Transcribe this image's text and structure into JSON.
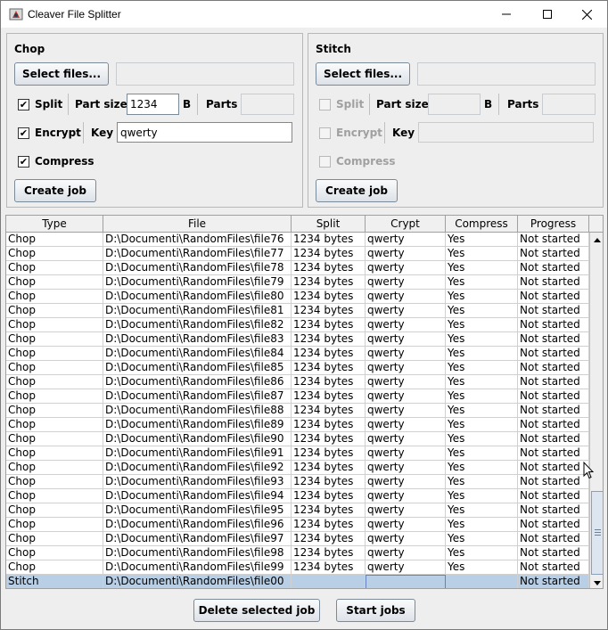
{
  "window": {
    "title": "Cleaver File Splitter"
  },
  "chop": {
    "title": "Chop",
    "select_files_label": "Select files...",
    "files_value": "",
    "split_label": "Split",
    "split_checked": true,
    "part_size_label": "Part size",
    "part_size_value": "1234",
    "part_size_unit": "B",
    "parts_label": "Parts",
    "parts_value": "",
    "encrypt_label": "Encrypt",
    "encrypt_checked": true,
    "key_label": "Key",
    "key_value": "qwerty",
    "compress_label": "Compress",
    "compress_checked": true,
    "create_job_label": "Create job"
  },
  "stitch": {
    "title": "Stitch",
    "select_files_label": "Select files...",
    "files_value": "",
    "split_label": "Split",
    "part_size_label": "Part size",
    "part_size_value": "",
    "part_size_unit": "B",
    "parts_label": "Parts",
    "parts_value": "",
    "encrypt_label": "Encrypt",
    "key_label": "Key",
    "key_value": "",
    "compress_label": "Compress",
    "create_job_label": "Create job"
  },
  "table": {
    "columns": [
      "Type",
      "File",
      "Split",
      "Crypt",
      "Compress",
      "Progress"
    ],
    "rows": [
      [
        "Chop",
        "D:\\Documenti\\RandomFiles\\file76",
        "1234 bytes",
        "qwerty",
        "Yes",
        "Not started"
      ],
      [
        "Chop",
        "D:\\Documenti\\RandomFiles\\file77",
        "1234 bytes",
        "qwerty",
        "Yes",
        "Not started"
      ],
      [
        "Chop",
        "D:\\Documenti\\RandomFiles\\file78",
        "1234 bytes",
        "qwerty",
        "Yes",
        "Not started"
      ],
      [
        "Chop",
        "D:\\Documenti\\RandomFiles\\file79",
        "1234 bytes",
        "qwerty",
        "Yes",
        "Not started"
      ],
      [
        "Chop",
        "D:\\Documenti\\RandomFiles\\file80",
        "1234 bytes",
        "qwerty",
        "Yes",
        "Not started"
      ],
      [
        "Chop",
        "D:\\Documenti\\RandomFiles\\file81",
        "1234 bytes",
        "qwerty",
        "Yes",
        "Not started"
      ],
      [
        "Chop",
        "D:\\Documenti\\RandomFiles\\file82",
        "1234 bytes",
        "qwerty",
        "Yes",
        "Not started"
      ],
      [
        "Chop",
        "D:\\Documenti\\RandomFiles\\file83",
        "1234 bytes",
        "qwerty",
        "Yes",
        "Not started"
      ],
      [
        "Chop",
        "D:\\Documenti\\RandomFiles\\file84",
        "1234 bytes",
        "qwerty",
        "Yes",
        "Not started"
      ],
      [
        "Chop",
        "D:\\Documenti\\RandomFiles\\file85",
        "1234 bytes",
        "qwerty",
        "Yes",
        "Not started"
      ],
      [
        "Chop",
        "D:\\Documenti\\RandomFiles\\file86",
        "1234 bytes",
        "qwerty",
        "Yes",
        "Not started"
      ],
      [
        "Chop",
        "D:\\Documenti\\RandomFiles\\file87",
        "1234 bytes",
        "qwerty",
        "Yes",
        "Not started"
      ],
      [
        "Chop",
        "D:\\Documenti\\RandomFiles\\file88",
        "1234 bytes",
        "qwerty",
        "Yes",
        "Not started"
      ],
      [
        "Chop",
        "D:\\Documenti\\RandomFiles\\file89",
        "1234 bytes",
        "qwerty",
        "Yes",
        "Not started"
      ],
      [
        "Chop",
        "D:\\Documenti\\RandomFiles\\file90",
        "1234 bytes",
        "qwerty",
        "Yes",
        "Not started"
      ],
      [
        "Chop",
        "D:\\Documenti\\RandomFiles\\file91",
        "1234 bytes",
        "qwerty",
        "Yes",
        "Not started"
      ],
      [
        "Chop",
        "D:\\Documenti\\RandomFiles\\file92",
        "1234 bytes",
        "qwerty",
        "Yes",
        "Not started"
      ],
      [
        "Chop",
        "D:\\Documenti\\RandomFiles\\file93",
        "1234 bytes",
        "qwerty",
        "Yes",
        "Not started"
      ],
      [
        "Chop",
        "D:\\Documenti\\RandomFiles\\file94",
        "1234 bytes",
        "qwerty",
        "Yes",
        "Not started"
      ],
      [
        "Chop",
        "D:\\Documenti\\RandomFiles\\file95",
        "1234 bytes",
        "qwerty",
        "Yes",
        "Not started"
      ],
      [
        "Chop",
        "D:\\Documenti\\RandomFiles\\file96",
        "1234 bytes",
        "qwerty",
        "Yes",
        "Not started"
      ],
      [
        "Chop",
        "D:\\Documenti\\RandomFiles\\file97",
        "1234 bytes",
        "qwerty",
        "Yes",
        "Not started"
      ],
      [
        "Chop",
        "D:\\Documenti\\RandomFiles\\file98",
        "1234 bytes",
        "qwerty",
        "Yes",
        "Not started"
      ],
      [
        "Chop",
        "D:\\Documenti\\RandomFiles\\file99",
        "1234 bytes",
        "qwerty",
        "Yes",
        "Not started"
      ],
      [
        "Stitch",
        "D:\\Documenti\\RandomFiles\\file00",
        "",
        "",
        "",
        "Not started"
      ]
    ],
    "selected_row": 24
  },
  "footer": {
    "delete_label": "Delete selected job",
    "start_label": "Start jobs"
  },
  "colors": {
    "selection": "#b8cfe5",
    "panel_bg": "#eeeeee",
    "focus_border": "#6382bf"
  }
}
